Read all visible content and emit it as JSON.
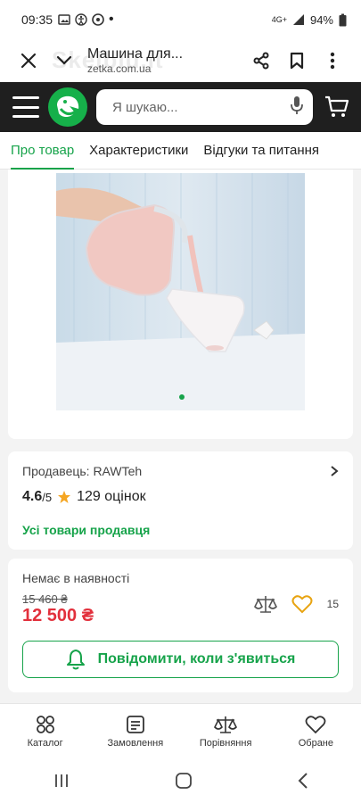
{
  "status": {
    "time": "09:35",
    "battery": "94%",
    "network": "4G+"
  },
  "browser": {
    "title": "Машина для...",
    "domain": "zetka.com.ua",
    "watermark": "Skelbiu.lt"
  },
  "search": {
    "placeholder": "Я шукаю..."
  },
  "tabs": [
    {
      "label": "Про товар"
    },
    {
      "label": "Характеристики"
    },
    {
      "label": "Відгуки та питання"
    }
  ],
  "seller": {
    "label": "Продавець: RAWTeh",
    "rating": "4.6",
    "rating_scale": "/5",
    "reviews": "129 оцінок",
    "all_goods_link": "Усі товари продавця"
  },
  "price": {
    "stock": "Немає в наявності",
    "old": "15 460 ₴",
    "new": "12 500 ₴",
    "favorites_count": "15"
  },
  "notify_button": {
    "label": "Повідомити, коли з'явиться"
  },
  "bottom_nav": [
    {
      "label": "Каталог"
    },
    {
      "label": "Замовлення"
    },
    {
      "label": "Порівняння"
    },
    {
      "label": "Обране"
    }
  ],
  "colors": {
    "accent": "#16a34a",
    "price": "#e2303c",
    "nav_bg": "#1f1f1f"
  }
}
